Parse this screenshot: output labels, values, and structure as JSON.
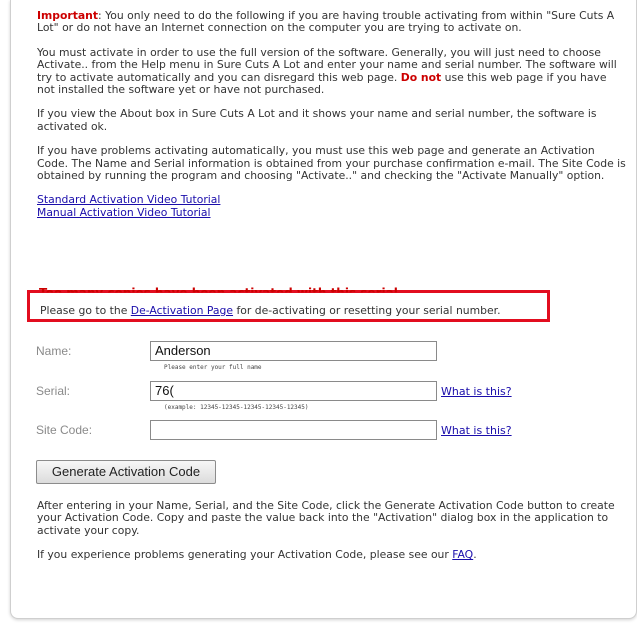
{
  "intro": {
    "important_label": "Important",
    "important_text": ": You only need to do the following if you are having trouble activating from within \"Sure Cuts A Lot\" or do not have an Internet connection on the computer you are trying to activate on.",
    "para2_before": "You must activate in order to use the full version of the software. Generally, you will just need to choose Activate.. from the Help menu in Sure Cuts A Lot and enter your name and serial number. The software will try to activate automatically and you can disregard this web page. ",
    "para2_do_not": "Do not",
    "para2_after": " use this web page if you have not installed the software yet or have not purchased.",
    "para3": "If you view the About box in Sure Cuts A Lot and it shows your name and serial number, the software is activated ok.",
    "para4": "If you have problems activating automatically, you must use this web page and generate an Activation Code. The Name and Serial information is obtained from your purchase confirmation e-mail. The Site Code is obtained by running the program and choosing \"Activate..\" and checking the \"Activate Manually\" option."
  },
  "links": {
    "standard_video": "Standard Activation Video Tutorial",
    "manual_video": "Manual Activation Video Tutorial"
  },
  "warning": {
    "title": "Too many copies have been activated with this serial",
    "before_link": "Please go to the ",
    "link": "De-Activation Page",
    "after_link": " for de-activating or resetting your serial number."
  },
  "form": {
    "name_label": "Name:",
    "name_value": "Anderson",
    "name_hint": "Please enter your full name",
    "serial_label": "Serial:",
    "serial_value": "76(",
    "serial_hint": "(example: 12345-12345-12345-12345-12345)",
    "serial_help": "What is this?",
    "site_label": "Site Code:",
    "site_value": "",
    "site_help": "What is this?"
  },
  "button": {
    "generate": "Generate Activation Code"
  },
  "after": {
    "para1": "After entering in your Name, Serial, and the Site Code, click the Generate Activation Code button to create your Activation Code. Copy and paste the value back into the \"Activation\" dialog box in the application to activate your copy.",
    "para2_before": "If you experience problems generating your Activation Code, please see our ",
    "faq": "FAQ",
    "para2_after": "."
  },
  "colors": {
    "important": "#cc0000",
    "link": "#1a0dab",
    "highlight_border": "#e20d1f"
  }
}
